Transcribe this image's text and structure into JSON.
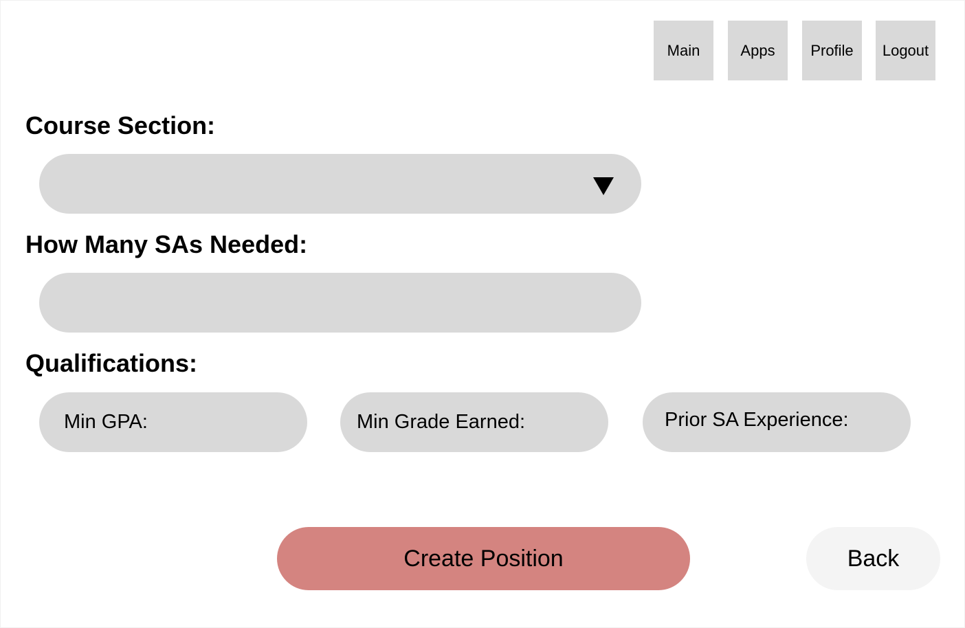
{
  "nav": {
    "main": "Main",
    "apps": "Apps",
    "profile": "Profile",
    "logout": "Logout"
  },
  "form": {
    "course_section_label": "Course Section:",
    "course_section_value": "",
    "sas_needed_label": "How Many SAs Needed:",
    "sas_needed_value": "",
    "qualifications_label": "Qualifications:",
    "qualifications": {
      "min_gpa": "Min GPA:",
      "min_grade": "Min Grade Earned:",
      "prior_experience": "Prior SA Experience:"
    }
  },
  "actions": {
    "create": "Create Position",
    "back": "Back"
  },
  "colors": {
    "field_bg": "#d9d9d9",
    "primary_button": "#d48480",
    "secondary_button": "#f4f4f4"
  },
  "icons": {
    "dropdown": "caret-down-icon"
  }
}
